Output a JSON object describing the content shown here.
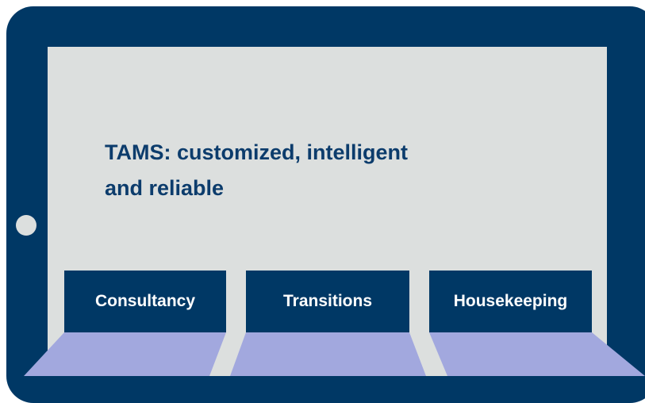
{
  "headline": {
    "line1": "TAMS: customized, intelligent",
    "line2": "and reliable"
  },
  "tiles": [
    {
      "label": "Consultancy"
    },
    {
      "label": "Transitions"
    },
    {
      "label": "Housekeeping"
    }
  ],
  "colors": {
    "frame": "#003865",
    "screen": "#dcdfde",
    "headline": "#0c3c6c",
    "tile": "#003865",
    "tile_text": "#ffffff",
    "keys": "#a2a8de"
  }
}
